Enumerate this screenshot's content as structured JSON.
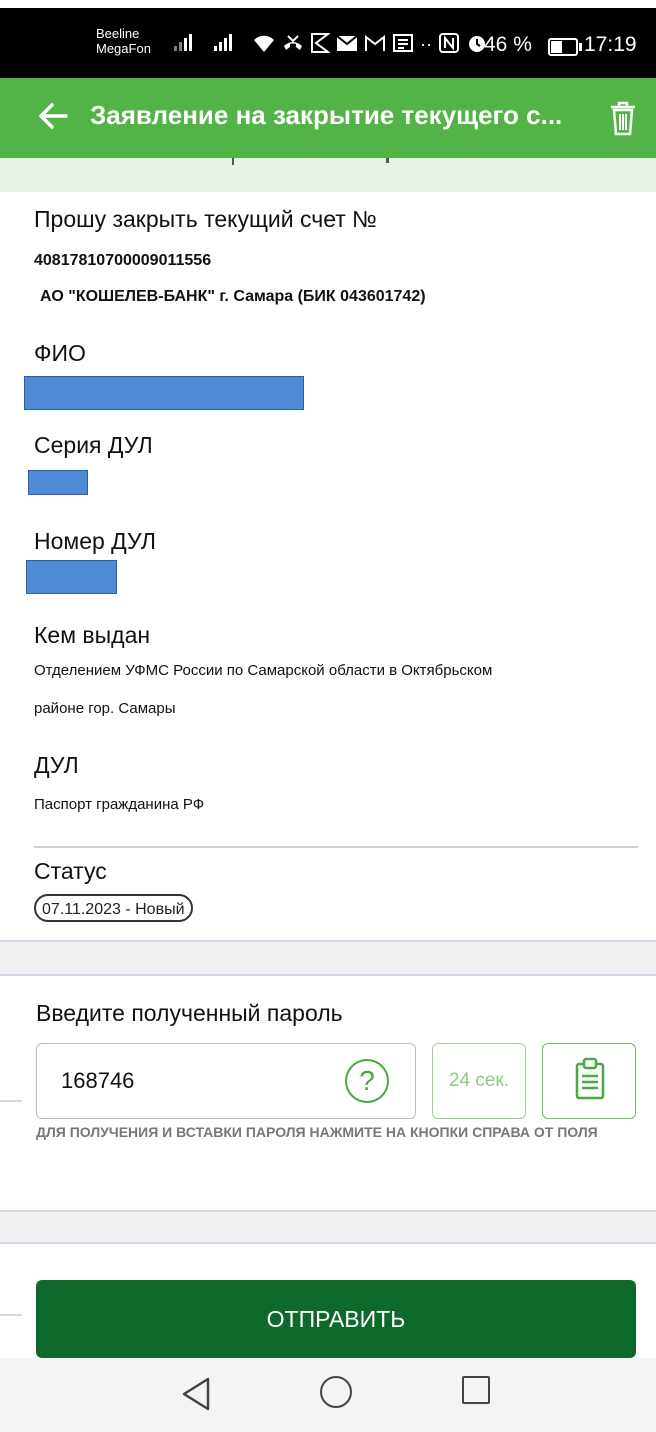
{
  "status_bar": {
    "carrier1": "Beeline",
    "carrier2": "MegaFon",
    "icons": [
      "wifi-icon",
      "missed-call-icon",
      "notification-icon",
      "mail-icon",
      "gmail-icon",
      "news-icon",
      "nfc-icon",
      "alarm-icon"
    ],
    "battery": "46 %",
    "time": "17:19"
  },
  "app_bar": {
    "title": "Заявление на закрытие текущего с...",
    "back_icon": "arrow-left-icon",
    "trash_icon": "trash-icon",
    "color": "#52b447"
  },
  "form": {
    "request_label": "Прошу закрыть текущий счет №",
    "account_number": "40817810700009011556",
    "bank": "АО \"КОШЕЛЕВ-БАНК\" г. Самара (БИК 043601742)",
    "fio_label": "ФИО",
    "series_label": "Серия ДУЛ",
    "number_label": "Номер ДУЛ",
    "issued_by_label": "Кем выдан",
    "issued_by_line1": "Отделением УФМС России по Самарской области в Октябрьском",
    "issued_by_line2": "районе гор. Самары",
    "dul_label": "ДУЛ",
    "dul_value": "Паспорт гражданина РФ",
    "status_label": "Статус",
    "status_value": "07.11.2023 - Новый"
  },
  "password": {
    "label": "Введите полученный пароль",
    "value": "168746",
    "help": "?",
    "timer": "24 сек.",
    "hint": "Для получения и вставки пароля нажмите на кнопки справа от поля"
  },
  "submit_label": "ОТПРАВИТЬ",
  "colors": {
    "accent": "#52b447",
    "submit": "#0e6a2c",
    "redaction": "#4f8bd6"
  }
}
